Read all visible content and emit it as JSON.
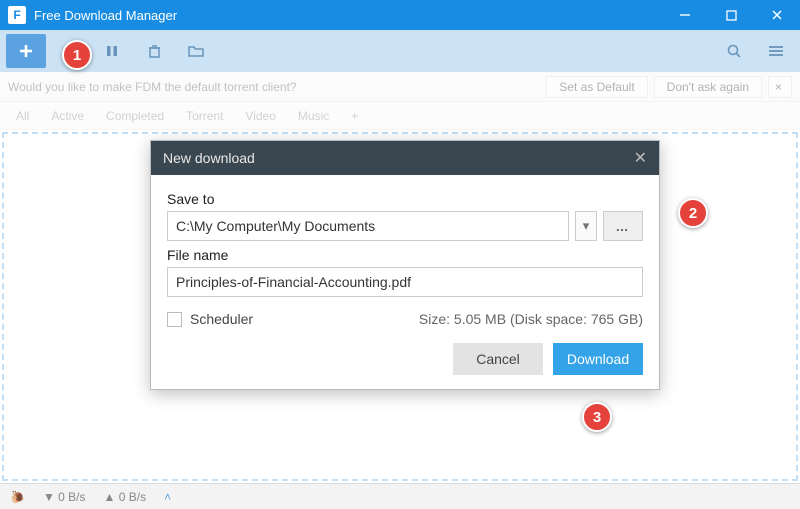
{
  "window": {
    "title": "Free Download Manager"
  },
  "notice": {
    "message": "Would you like to make FDM the default torrent client?",
    "set_default": "Set as Default",
    "dont_ask": "Don't ask again"
  },
  "tabs": {
    "all": "All",
    "active": "Active",
    "completed": "Completed",
    "torrent": "Torrent",
    "video": "Video",
    "music": "Music"
  },
  "dialog": {
    "title": "New download",
    "save_to_label": "Save to",
    "save_to_path": "C:\\My Computer\\My Documents",
    "file_name_label": "File name",
    "file_name": "Principles-of-Financial-Accounting.pdf",
    "scheduler_label": "Scheduler",
    "size_info": "Size: 5.05 MB (Disk space: 765 GB)",
    "cancel": "Cancel",
    "download": "Download",
    "browse_label": "…"
  },
  "status": {
    "down": "▼ 0 B/s",
    "up": "▲ 0 B/s"
  },
  "callouts": {
    "c1": "1",
    "c2": "2",
    "c3": "3"
  }
}
